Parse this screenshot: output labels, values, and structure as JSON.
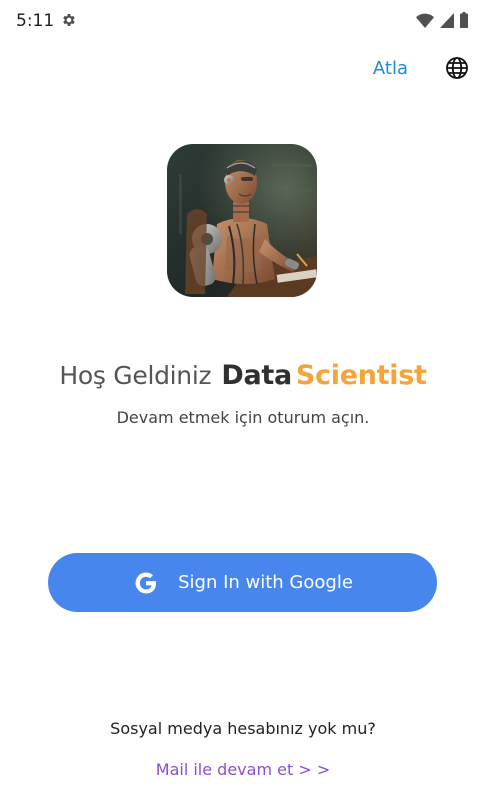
{
  "status_bar": {
    "time": "5:11",
    "icons": [
      "settings-icon",
      "wifi-icon",
      "signal-icon",
      "battery-icon"
    ]
  },
  "header": {
    "skip_label": "Atla",
    "language_icon": "globe-icon"
  },
  "logo": {
    "icon": "robot-scientist-illustration"
  },
  "welcome": {
    "greeting": "Hoş Geldiniz",
    "brand_part1": "Data",
    "brand_part2": "Scientist",
    "subtitle": "Devam etmek için oturum açın."
  },
  "actions": {
    "google_label": "Sign In with Google",
    "google_icon": "google-g-icon",
    "no_account_text": "Sosyal medya hesabınız yok mu?",
    "mail_link_label": "Mail ile devam et > >"
  },
  "colors": {
    "accent_blue": "#4787ed",
    "link_blue": "#1e88e5",
    "brand_orange": "#f5a43a",
    "link_purple": "#8a4fd8"
  }
}
